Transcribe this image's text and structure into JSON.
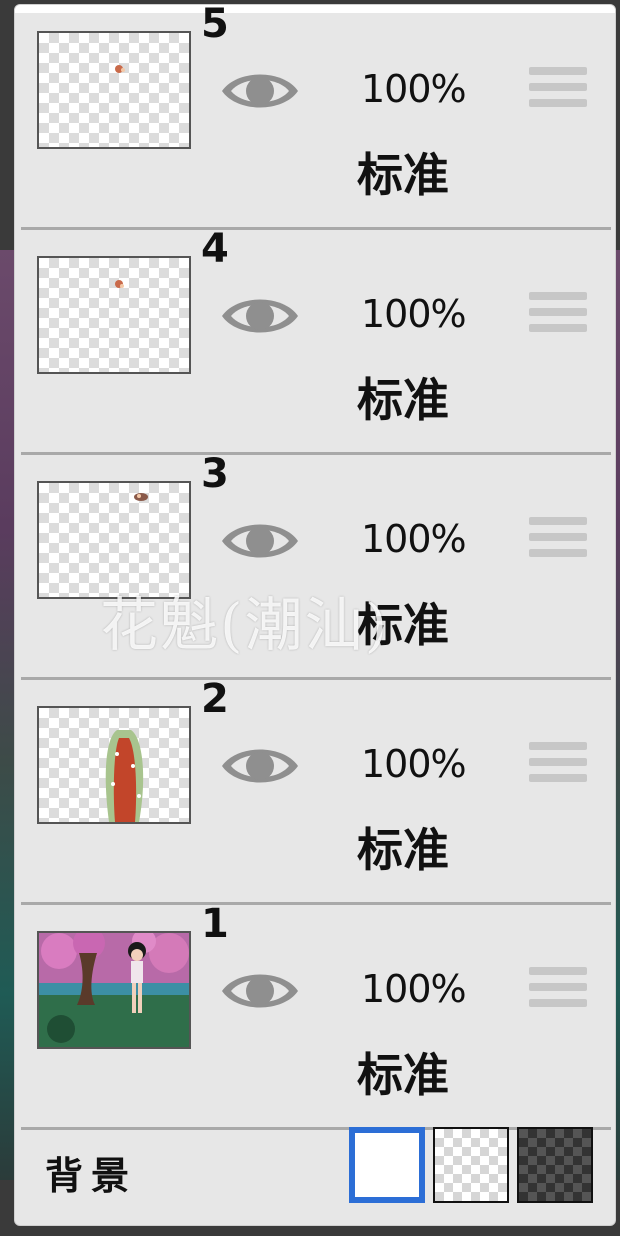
{
  "layers": [
    {
      "number": "5",
      "opacity": "100%",
      "blend": "标准",
      "visible": true
    },
    {
      "number": "4",
      "opacity": "100%",
      "blend": "标准",
      "visible": true
    },
    {
      "number": "3",
      "opacity": "100%",
      "blend": "标准",
      "visible": true
    },
    {
      "number": "2",
      "opacity": "100%",
      "blend": "标准",
      "visible": true
    },
    {
      "number": "1",
      "opacity": "100%",
      "blend": "标准",
      "visible": true
    }
  ],
  "background": {
    "label": "背景",
    "options": [
      "white",
      "transparent",
      "dark-checker"
    ],
    "selected": "white",
    "accent_color": "#2c6ed6"
  },
  "watermark": "花魁(潮汕)",
  "icons": {
    "visibility": "eye-icon",
    "drag": "drag-handle-icon"
  }
}
